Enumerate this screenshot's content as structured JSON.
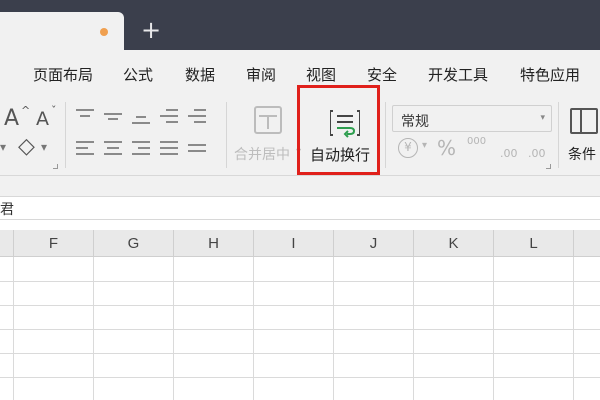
{
  "tab_bar": {
    "new_tab": "+"
  },
  "menu": {
    "items": [
      "页面布局",
      "公式",
      "数据",
      "审阅",
      "视图",
      "安全",
      "开发工具",
      "特色应用"
    ]
  },
  "ribbon": {
    "font_grow": "A",
    "font_shrink": "A",
    "merge_label": "合并居中",
    "wrap_text_label": "自动换行",
    "number_format": "常规",
    "currency": "¥",
    "percent": "%",
    "thousands": "000",
    "dec_increase": ".00",
    "dec_decrease": ".00",
    "conditional_label": "条件"
  },
  "formula_bar": {
    "content": "君"
  },
  "sheet": {
    "columns": [
      "F",
      "G",
      "H",
      "I",
      "J",
      "K",
      "L"
    ]
  },
  "colors": {
    "accent_highlight": "#e0201b",
    "titlebar": "#3b3f4c",
    "wrap_icon_green": "#2e9e4f"
  }
}
